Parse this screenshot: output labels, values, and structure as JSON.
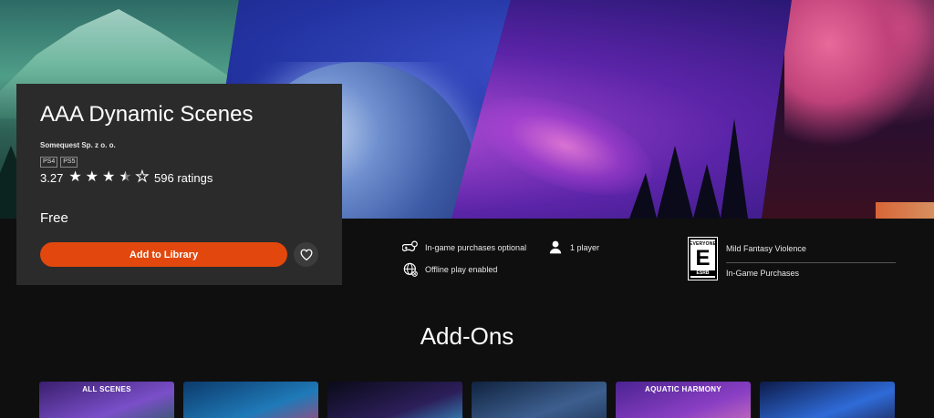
{
  "product": {
    "title": "AAA Dynamic Scenes",
    "publisher": "Somequest Sp. z o. o.",
    "platforms": [
      "PS4",
      "PS5"
    ],
    "rating_value": "3.27",
    "rating_stars": 3.5,
    "rating_count": "596 ratings",
    "price": "Free",
    "add_button_label": "Add to Library",
    "wishlist_icon": "heart-icon"
  },
  "features": {
    "purchases": "In-game purchases optional",
    "players": "1 player",
    "offline": "Offline play enabled"
  },
  "esrb": {
    "top_text": "EVERYONE",
    "letter": "E",
    "bottom_text": "ESRB",
    "descriptors": [
      "Mild Fantasy Violence",
      "In-Game Purchases"
    ]
  },
  "addons": {
    "heading": "Add-Ons",
    "items": [
      {
        "label": "ALL SCENES",
        "colors": [
          "#3a1f6e",
          "#7a4fc9",
          "#1d5e4c"
        ]
      },
      {
        "label": "",
        "colors": [
          "#0c3a6b",
          "#1f7ab8",
          "#c23d6a"
        ]
      },
      {
        "label": "",
        "colors": [
          "#0a0a18",
          "#2c1f5a",
          "#3aa8d8"
        ]
      },
      {
        "label": "",
        "colors": [
          "#10233f",
          "#3d5f8f",
          "#1a2e4c"
        ]
      },
      {
        "label": "AQUATIC HARMONY",
        "colors": [
          "#4b2390",
          "#8a3fc4",
          "#d87ab8"
        ]
      },
      {
        "label": "",
        "colors": [
          "#0d1b4a",
          "#2f6bd8",
          "#1a1a3a"
        ]
      }
    ]
  },
  "colors": {
    "accent": "#e2480d",
    "card": "#2b2b2b",
    "background": "#0f0f0f"
  }
}
